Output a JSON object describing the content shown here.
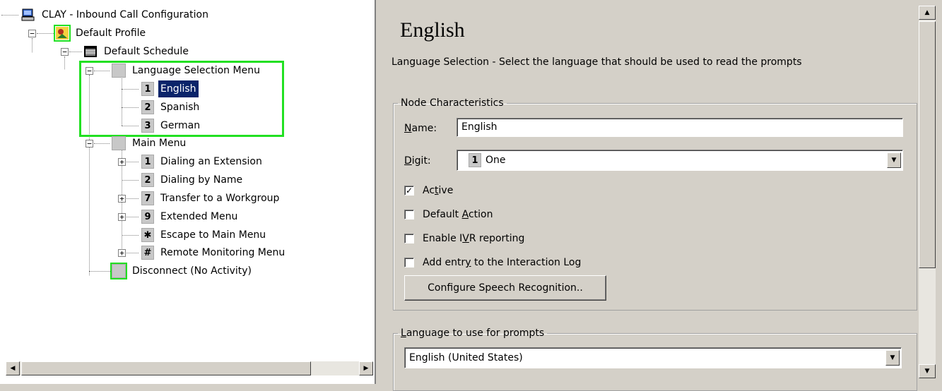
{
  "tree": {
    "root": "CLAY - Inbound Call Configuration",
    "profile": "Default Profile",
    "schedule": "Default Schedule",
    "language_menu": "Language Selection Menu",
    "languages": [
      {
        "digit": "1",
        "label": "English"
      },
      {
        "digit": "2",
        "label": "Spanish"
      },
      {
        "digit": "3",
        "label": "German"
      }
    ],
    "main_menu": "Main Menu",
    "main_items": [
      {
        "digit": "1",
        "label": "Dialing an Extension"
      },
      {
        "digit": "2",
        "label": "Dialing by Name"
      },
      {
        "digit": "7",
        "label": "Transfer to a Workgroup"
      },
      {
        "digit": "9",
        "label": "Extended Menu"
      },
      {
        "digit": "✱",
        "label": "Escape to Main Menu"
      },
      {
        "digit": "#",
        "label": "Remote Monitoring Menu"
      }
    ],
    "disconnect": "Disconnect (No Activity)"
  },
  "detail": {
    "title": "English",
    "description": "Language Selection - Select the language that should be used to read the prompts",
    "node_characteristics": {
      "legend": "Node Characteristics",
      "name_label_key": "N",
      "name_label_rest": "ame:",
      "name_value": "English",
      "digit_label_key": "D",
      "digit_label_rest": "igit:",
      "digit_value_num": "1",
      "digit_value_text": "One",
      "active": {
        "pre": "Ac",
        "key": "t",
        "post": "ive",
        "checked": true
      },
      "default_action": {
        "pre": "Default ",
        "key": "A",
        "post": "ction",
        "checked": false
      },
      "ivr": {
        "pre": "Enable I",
        "key": "V",
        "post": "R reporting",
        "checked": false
      },
      "interaction_log": {
        "pre": "Add entr",
        "key": "y",
        "post": " to the Interaction Log",
        "checked": false
      },
      "speech_button": "Configure Speech Recognition.."
    },
    "prompts": {
      "legend_key": "L",
      "legend_rest": "anguage to use for prompts",
      "value": "English (United States)"
    }
  },
  "colors": {
    "highlight": "#22e022",
    "selection": "#0a246a",
    "panel": "#d4d0c8"
  },
  "icons": {
    "root": "computer-icon",
    "profile": "profile-icon",
    "schedule": "schedule-icon",
    "node": "menu-node-icon"
  }
}
